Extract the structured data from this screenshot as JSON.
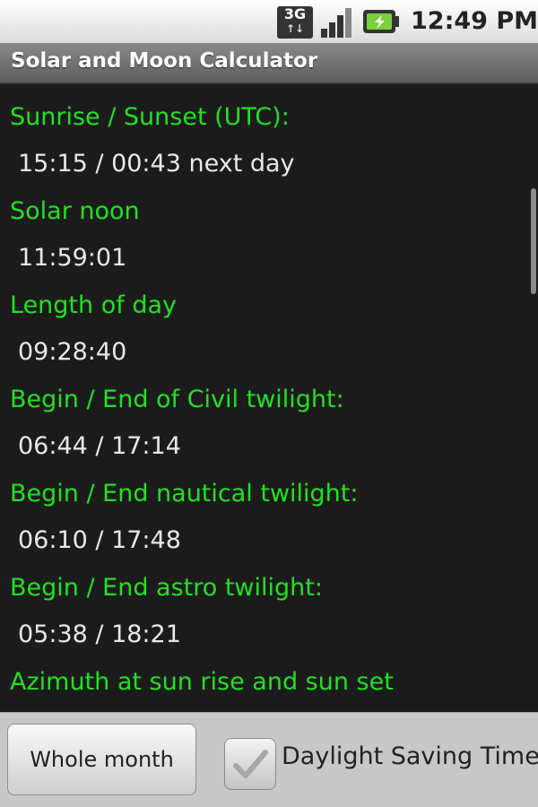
{
  "status_bar": {
    "network_label": "3G",
    "time": "12:49 PM",
    "icons": [
      "3g-network-icon",
      "signal-strength-icon",
      "battery-charging-icon"
    ]
  },
  "app": {
    "title": "Solar and Moon Calculator"
  },
  "entries": [
    {
      "label": "Sunrise / Sunset (UTC):",
      "value": "15:15 / 00:43 next day"
    },
    {
      "label": "Solar noon",
      "value": "11:59:01"
    },
    {
      "label": "Length of day",
      "value": "09:28:40"
    },
    {
      "label": "Begin / End of Civil twilight:",
      "value": "06:44 / 17:14"
    },
    {
      "label": "Begin / End nautical twilight:",
      "value": "06:10 / 17:48"
    },
    {
      "label": "Begin / End astro twilight:",
      "value": "05:38 / 18:21"
    },
    {
      "label": "Azimuth at sun rise and sun set",
      "value": ""
    }
  ],
  "controls": {
    "whole_month_label": "Whole month",
    "dst_label": "Daylight Saving Time",
    "dst_checked": false
  },
  "colors": {
    "label_green": "#22e022",
    "value_text": "#e8e8e8",
    "background": "#1b1b1b"
  }
}
